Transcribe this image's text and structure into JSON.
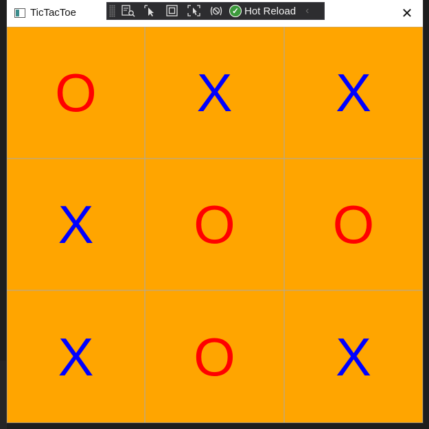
{
  "window": {
    "title": "TicTacToe",
    "close_glyph": "✕"
  },
  "toolbar": {
    "icons": [
      "visual-tree-icon",
      "select-element-icon",
      "display-adorners-icon",
      "track-focus-icon",
      "binding-failures-icon"
    ],
    "hot_reload_label": "Hot Reload",
    "hot_reload_status_glyph": "✓",
    "collapse_glyph": "‹"
  },
  "board": {
    "cells": [
      {
        "mark": "O"
      },
      {
        "mark": "X"
      },
      {
        "mark": "X"
      },
      {
        "mark": "X"
      },
      {
        "mark": "O"
      },
      {
        "mark": "O"
      },
      {
        "mark": "X"
      },
      {
        "mark": "O"
      },
      {
        "mark": "X"
      }
    ],
    "colors": {
      "background": "#FFA500",
      "O": "#FF0000",
      "X": "#0000FF",
      "grid": "#A9A9A9"
    }
  }
}
